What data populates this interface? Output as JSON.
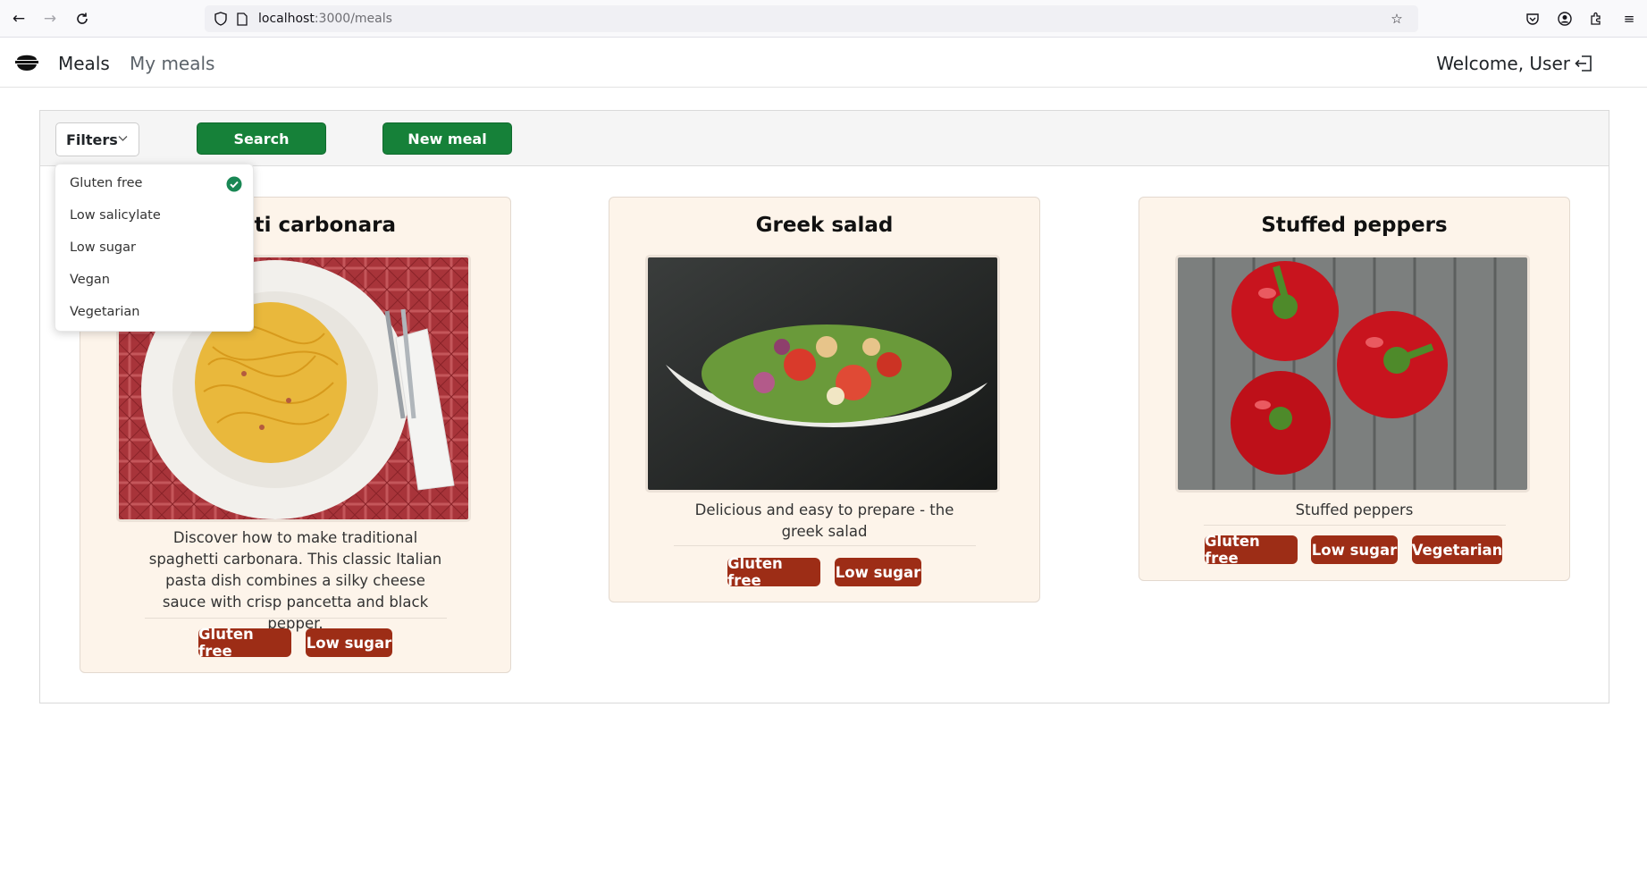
{
  "browser": {
    "url_host": "localhost",
    "url_path": ":3000/meals"
  },
  "nav": {
    "links": [
      "Meals",
      "My meals"
    ],
    "welcome": "Welcome, User"
  },
  "toolbar": {
    "filters_label": "Filters",
    "search_label": "Search",
    "new_meal_label": "New meal"
  },
  "filters_dropdown": {
    "items": [
      {
        "label": "Gluten free",
        "checked": true
      },
      {
        "label": "Low salicylate",
        "checked": false
      },
      {
        "label": "Low sugar",
        "checked": false
      },
      {
        "label": "Vegan",
        "checked": false
      },
      {
        "label": "Vegetarian",
        "checked": false
      }
    ]
  },
  "meals": [
    {
      "title": "Spaghetti carbonara",
      "visible_title": "etti carbonara",
      "description": "Discover how to make traditional spaghetti carbonara. This classic Italian pasta dish combines a silky cheese sauce with crisp pancetta and black pepper.",
      "tags": [
        "Gluten free",
        "Low sugar"
      ]
    },
    {
      "title": "Greek salad",
      "description": "Delicious and easy to prepare - the greek salad",
      "tags": [
        "Gluten free",
        "Low sugar"
      ]
    },
    {
      "title": "Stuffed peppers",
      "description": "Stuffed peppers",
      "tags": [
        "Gluten free",
        "Low sugar",
        "Vegetarian"
      ]
    }
  ],
  "colors": {
    "primary_green": "#168139",
    "tag_red": "#9d2d16",
    "card_bg": "#fdf4ea",
    "check_green": "#198754"
  }
}
